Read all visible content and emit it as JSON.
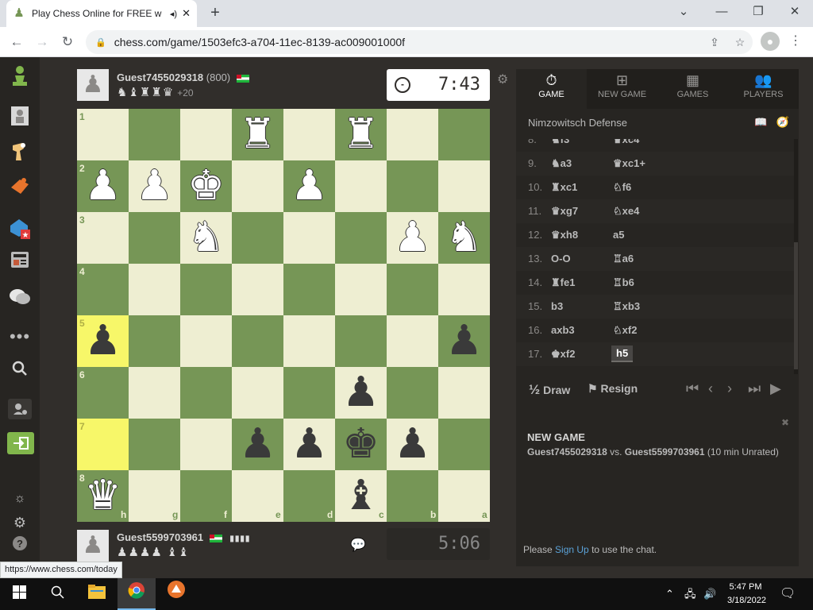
{
  "browser": {
    "tab_title": "Play Chess Online for FREE w",
    "tab_audio": "◂)",
    "url": "chess.com/game/1503efc3-a704-11ec-8139-ac009001000f",
    "status_url": "https://www.chess.com/today",
    "icons": {
      "back": "←",
      "forward": "→",
      "reload": "↻",
      "lock": "🔒",
      "share": "⇪",
      "star": "☆",
      "profile": "●",
      "menu": "⋮",
      "new_tab": "+",
      "minimize": "—",
      "restore": "❐",
      "close": "✕",
      "tab_close": "✕",
      "favicon": "♟",
      "collapse": "⌄"
    }
  },
  "sidebar": {
    "icons": [
      "pawn-logo",
      "play",
      "puzzles",
      "learn",
      "watch",
      "news",
      "social",
      "more",
      "search",
      "settings-user",
      "sign-in",
      "theme",
      "settings",
      "help"
    ]
  },
  "game": {
    "top_player": {
      "name": "Guest7455029318",
      "rating": "(800)",
      "captured": "♞♝♜♜♛",
      "advantage": "+20",
      "clock": "7:43",
      "clock_icon": "-"
    },
    "bottom_player": {
      "name": "Guest5599703961",
      "pips": "▮▮▮▮",
      "captured": "♟♟♟♟ ♝♝",
      "clock": "5:06"
    },
    "ranks": [
      "1",
      "2",
      "3",
      "4",
      "5",
      "6",
      "7",
      "8"
    ],
    "files": [
      "h",
      "g",
      "f",
      "e",
      "d",
      "c",
      "b",
      "a"
    ],
    "pieces": [
      {
        "sq": "e1",
        "p": "♜",
        "c": "w"
      },
      {
        "sq": "c1",
        "p": "♜",
        "c": "w"
      },
      {
        "sq": "h2",
        "p": "♟",
        "c": "w"
      },
      {
        "sq": "g2",
        "p": "♟",
        "c": "w"
      },
      {
        "sq": "f2",
        "p": "♚",
        "c": "w"
      },
      {
        "sq": "d2",
        "p": "♟",
        "c": "w"
      },
      {
        "sq": "f3",
        "p": "♞",
        "c": "w"
      },
      {
        "sq": "b3",
        "p": "♟",
        "c": "w"
      },
      {
        "sq": "a3",
        "p": "♞",
        "c": "w"
      },
      {
        "sq": "h5",
        "p": "♟",
        "c": "b"
      },
      {
        "sq": "a5",
        "p": "♟",
        "c": "b"
      },
      {
        "sq": "c6",
        "p": "♟",
        "c": "b"
      },
      {
        "sq": "e7",
        "p": "♟",
        "c": "b"
      },
      {
        "sq": "d7",
        "p": "♟",
        "c": "b"
      },
      {
        "sq": "c7",
        "p": "♚",
        "c": "b"
      },
      {
        "sq": "b7",
        "p": "♟",
        "c": "b"
      },
      {
        "sq": "h8",
        "p": "♛",
        "c": "w"
      },
      {
        "sq": "c8",
        "p": "♝",
        "c": "b"
      }
    ],
    "highlights": [
      "h5",
      "h7"
    ]
  },
  "panel": {
    "tabs": [
      {
        "label": "GAME",
        "icon": "⏱"
      },
      {
        "label": "NEW GAME",
        "icon": "⊞"
      },
      {
        "label": "GAMES",
        "icon": "▦"
      },
      {
        "label": "PLAYERS",
        "icon": "👥"
      }
    ],
    "opening": "Nimzowitsch Defense",
    "moves": [
      {
        "n": "8.",
        "w": "♞f3",
        "b": "♛xc4"
      },
      {
        "n": "9.",
        "w": "♞a3",
        "b": "♛xc1+"
      },
      {
        "n": "10.",
        "w": "♜xc1",
        "b": "♘f6"
      },
      {
        "n": "11.",
        "w": "♛xg7",
        "b": "♘xe4"
      },
      {
        "n": "12.",
        "w": "♛xh8",
        "b": "a5"
      },
      {
        "n": "13.",
        "w": "O-O",
        "b": "♖a6"
      },
      {
        "n": "14.",
        "w": "♜fe1",
        "b": "♖b6"
      },
      {
        "n": "15.",
        "w": "b3",
        "b": "♖xb3"
      },
      {
        "n": "16.",
        "w": "axb3",
        "b": "♘xf2"
      },
      {
        "n": "17.",
        "w": "♚xf2",
        "b": "h5"
      }
    ],
    "draw": "Draw",
    "draw_icon": "½",
    "resign": "Resign",
    "nav_icons": [
      "⏮",
      "‹",
      "›",
      "⏭",
      "▶"
    ],
    "notice_title": "NEW GAME",
    "notice_white": "Guest7455029318",
    "notice_vs": " vs. ",
    "notice_black": "Guest5599703961",
    "notice_detail": " (10 min Unrated)",
    "chat_prefix": "Please ",
    "chat_link": "Sign Up",
    "chat_suffix": " to use the chat."
  },
  "taskbar": {
    "time": "5:47 PM",
    "date": "3/18/2022"
  }
}
